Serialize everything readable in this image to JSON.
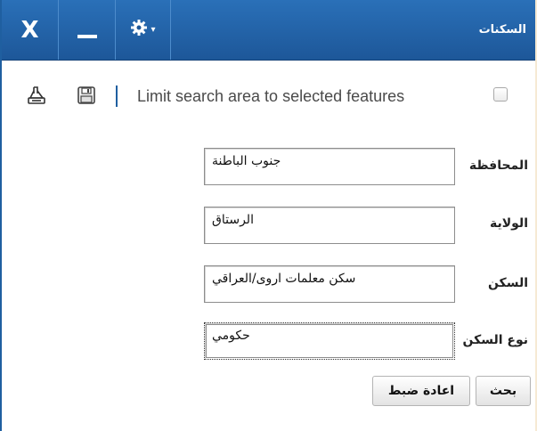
{
  "window": {
    "title": "السكنات",
    "close_label": "X",
    "gear_caret": "▾"
  },
  "toolbar": {
    "limit_label": "Limit search area to selected features",
    "limit_checked": false
  },
  "form": {
    "fields": [
      {
        "label": "المحافظة",
        "value": "جنوب الباطنة"
      },
      {
        "label": "الولاية",
        "value": "الرستاق"
      },
      {
        "label": "السكن",
        "value": "سكن معلمات اروى/العراقي"
      },
      {
        "label": "نوع السكن",
        "value": "حكومي"
      }
    ]
  },
  "buttons": {
    "reset": "اعادة ضبط",
    "search": "بحث"
  },
  "colors": {
    "titlebar": "#1d5799",
    "accent": "#1f5fa0",
    "background": "#f6ead4"
  },
  "icons": {
    "close": "close-icon",
    "minimize": "minimize-icon",
    "settings": "gear-icon",
    "print": "print-icon",
    "save": "save-icon"
  }
}
